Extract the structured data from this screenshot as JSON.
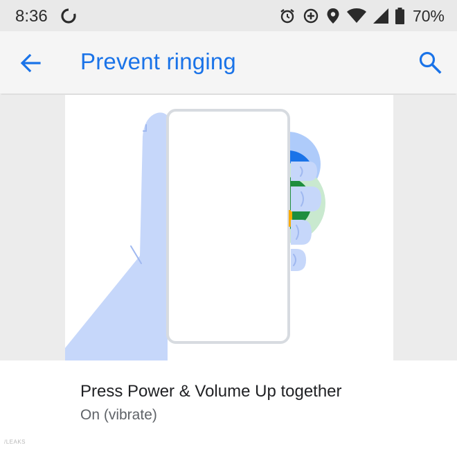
{
  "status_bar": {
    "time": "8:36",
    "battery_percent": "70%",
    "icons": [
      "sync-icon",
      "alarm-icon",
      "data-saver-icon",
      "location-icon",
      "wifi-icon",
      "cell-signal-icon",
      "battery-icon"
    ]
  },
  "app_bar": {
    "title": "Prevent ringing",
    "back_icon": "arrow-back-icon",
    "search_icon": "search-icon"
  },
  "colors": {
    "accent": "#1a73e8",
    "hand": "#c6d7fa",
    "green_ring": "#c9e9cf",
    "green": "#1e8e3e",
    "blue": "#1a73e8",
    "yellow": "#f9ab00"
  },
  "setting": {
    "title": "Press Power & Volume Up together",
    "summary": "On (vibrate)"
  },
  "watermark": "/LEAKS"
}
